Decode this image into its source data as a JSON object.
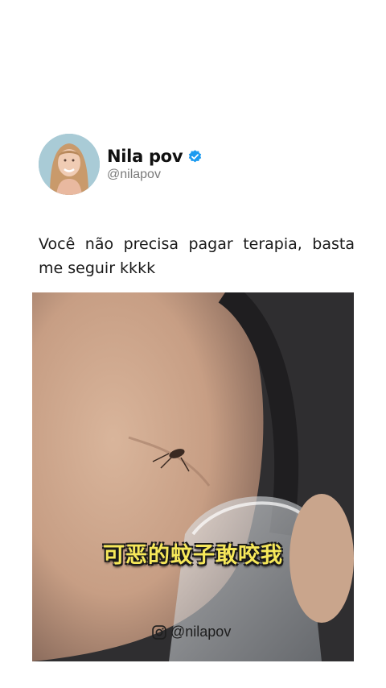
{
  "profile": {
    "display_name": "Nila pov",
    "handle": "@nilapov",
    "verified": true,
    "verified_color": "#1d9bf0"
  },
  "post": {
    "text": "Você não precisa pagar terapia, basta me seguir kkkk"
  },
  "media": {
    "subtitle": "可恶的蚊子敢咬我",
    "watermark": "@nilapov",
    "icons": [
      "instagram-icon"
    ]
  }
}
